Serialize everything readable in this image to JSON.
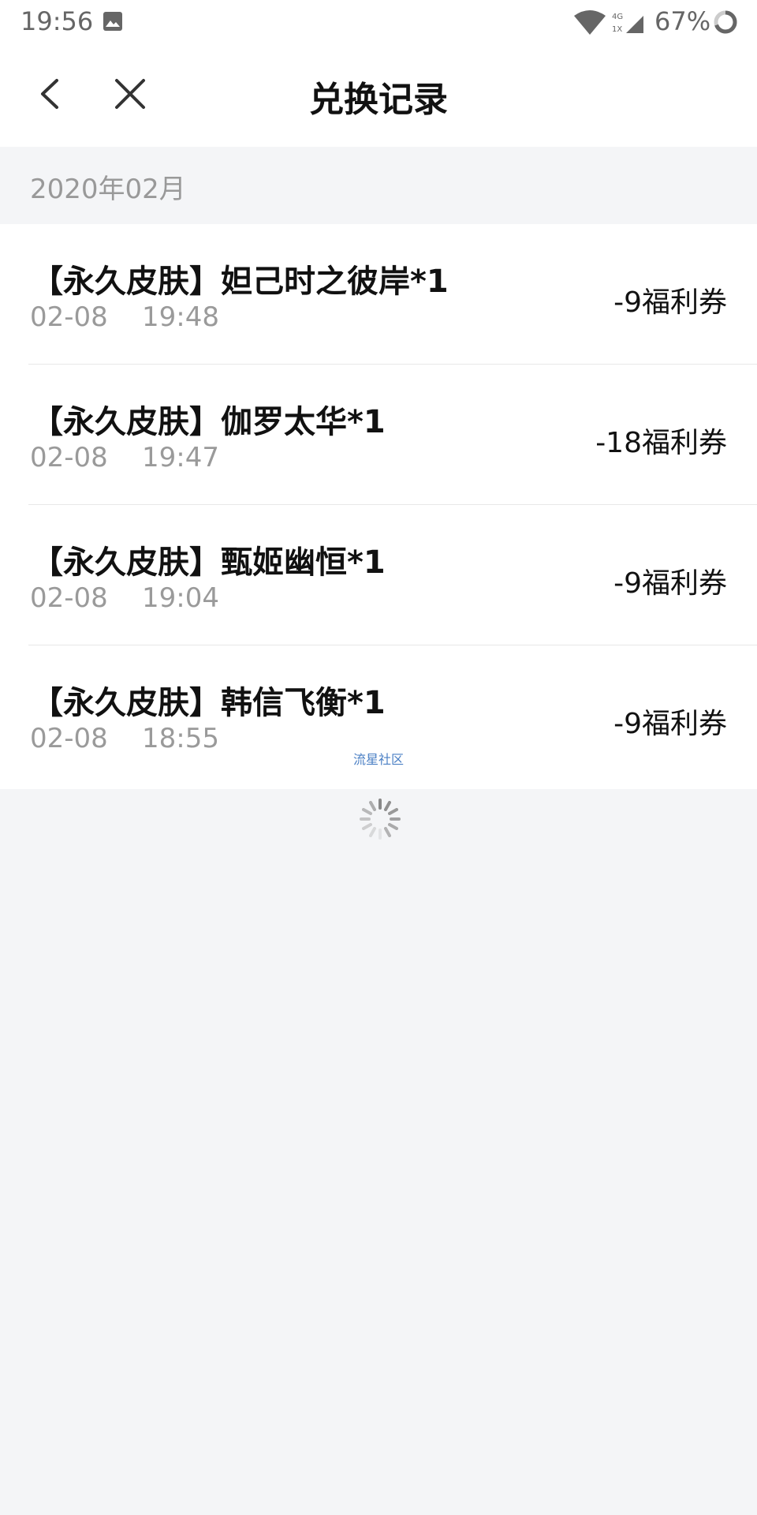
{
  "status_bar": {
    "time": "19:56",
    "battery": "67%",
    "icons": [
      "gallery-icon",
      "wifi-icon",
      "signal-icon",
      "battery-icon"
    ]
  },
  "nav": {
    "title": "兑换记录",
    "back_icon": "chevron-left-icon",
    "close_icon": "close-icon"
  },
  "month_header": "2020年02月",
  "records": [
    {
      "title": "【永久皮肤】妲己时之彼岸*1",
      "date": "02-08",
      "time": "19:48",
      "amount": "-9福利券"
    },
    {
      "title": "【永久皮肤】伽罗太华*1",
      "date": "02-08",
      "time": "19:47",
      "amount": "-18福利券"
    },
    {
      "title": "【永久皮肤】甄姬幽恒*1",
      "date": "02-08",
      "time": "19:04",
      "amount": "-9福利券"
    },
    {
      "title": "【永久皮肤】韩信飞衡*1",
      "date": "02-08",
      "time": "18:55",
      "amount": "-9福利券"
    }
  ],
  "watermark": "流星社区",
  "colors": {
    "background": "#f4f5f7",
    "card": "#ffffff",
    "title_text": "#111111",
    "secondary_text": "#9a9a9a"
  }
}
